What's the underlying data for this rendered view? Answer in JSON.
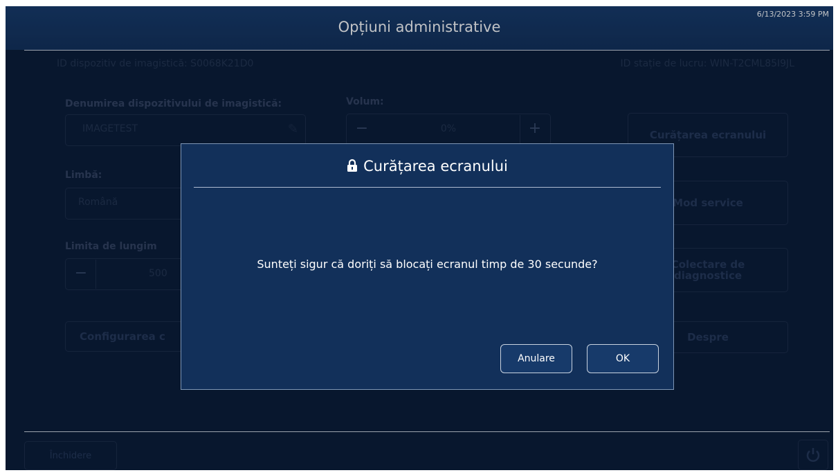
{
  "header": {
    "title": "Opțiuni administrative",
    "timestamp": "6/13/2023 3:59 PM"
  },
  "info": {
    "device_id": "ID dispozitiv de imagistică: S0068K21D0",
    "workstation_id": "ID stație de lucru: WIN-T2CML85I9JL"
  },
  "form": {
    "device_name_label": "Denumirea dispozitivului de imagistică:",
    "device_name_value": "IMAGETEST",
    "volume_label": "Volum:",
    "volume_value": "0%",
    "language_label": "Limbă:",
    "language_value": "Română",
    "length_limit_label": "Limita de lungim",
    "length_limit_value": "500"
  },
  "buttons": {
    "screen_clean": "Curățarea ecranului",
    "service_mode": "Mod service",
    "diagnostics_line1": "Colectare de",
    "diagnostics_line2": "diagnostice",
    "configure": "Configurarea c",
    "about": "Despre",
    "close": "Închidere"
  },
  "dialog": {
    "title": "Curățarea ecranului",
    "icon": "lock-icon",
    "message": "Sunteți sigur că doriți să blocați ecranul timp de 30 secunde?",
    "cancel_label": "Anulare",
    "ok_label": "OK"
  },
  "colors": {
    "background": "#0a1b36",
    "header": "#12305a",
    "dialog": "#12305a",
    "accent_text": "#ffffff"
  }
}
